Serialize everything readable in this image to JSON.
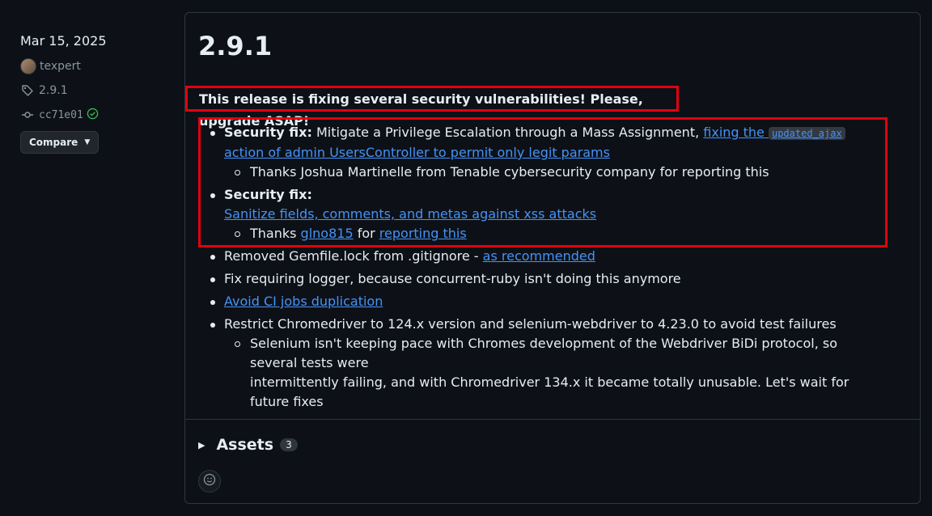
{
  "sidebar": {
    "date": "Mar 15, 2025",
    "author": "texpert",
    "tag": "2.9.1",
    "commit": "cc71e01",
    "compare_label": "Compare"
  },
  "release": {
    "title": "2.9.1",
    "notice": "This release is fixing several security vulnerabilities! Please, upgrade ASAP!",
    "items": [
      {
        "bold": "Security fix:",
        "text": " Mitigate a Privilege Escalation through a Mass Assignment, ",
        "link1": "fixing the ",
        "code": "updated_ajax",
        "link2": " action of admin UsersController to permit only legit params",
        "sub": "Thanks Joshua Martinelle from Tenable cybersecurity company for reporting this"
      },
      {
        "bold": "Security fix:",
        "link": "Sanitize fields, comments, and metas against xss attacks",
        "sub_pre": "Thanks ",
        "sub_link1": "glno815",
        "sub_mid": " for ",
        "sub_link2": "reporting this"
      },
      {
        "text": "Removed Gemfile.lock from .gitignore - ",
        "link": "as recommended"
      },
      {
        "text": "Fix requiring logger, because concurrent-ruby isn't doing this anymore"
      },
      {
        "link": "Avoid CI jobs duplication"
      },
      {
        "text": "Restrict Chromedriver to 124.x version and selenium-webdriver to 4.23.0 to avoid test failures",
        "sub_line1": "Selenium isn't keeping pace with Chromes development of the Webdriver BiDi protocol, so several tests were",
        "sub_line2": "intermittently failing, and with Chromedriver 134.x it became totally unusable. Let's wait for future fixes"
      }
    ]
  },
  "assets": {
    "label": "Assets",
    "count": "3"
  },
  "colors": {
    "background": "#0d1117",
    "link": "#4493f8",
    "highlight": "#e3000f",
    "border": "#30363d"
  }
}
